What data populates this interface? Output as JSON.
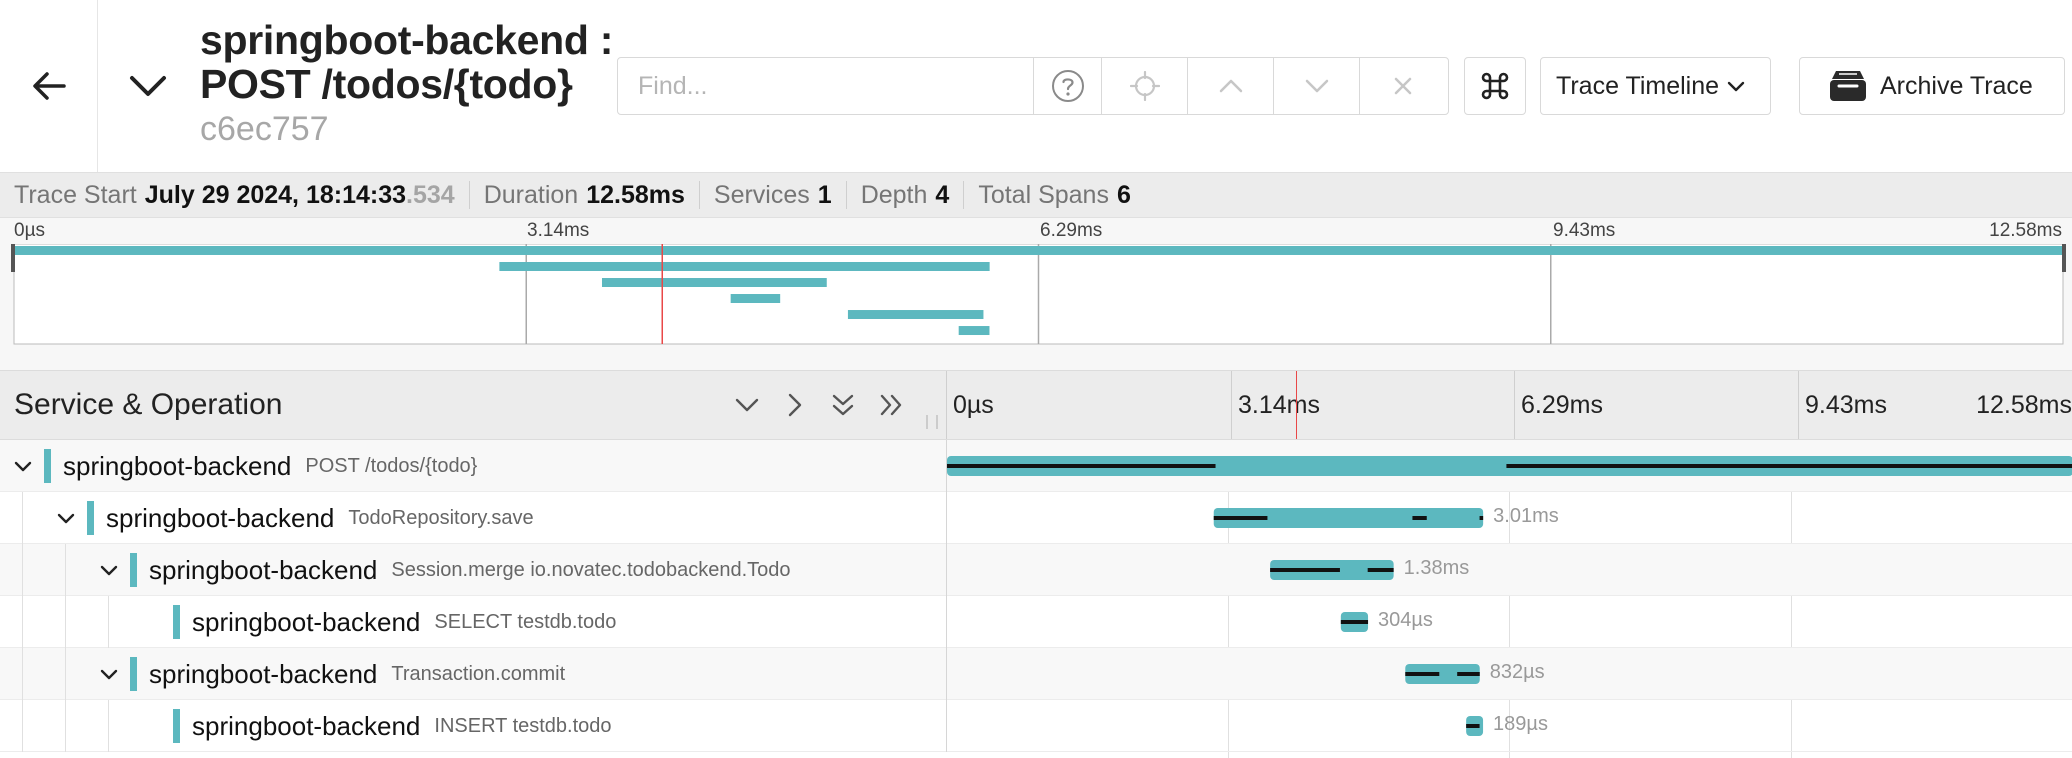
{
  "header": {
    "title_line1": "springboot-backend :",
    "title_line2": "POST /todos/{todo}",
    "trace_id": "c6ec757",
    "find_placeholder": "Find...",
    "view_dropdown": "Trace Timeline",
    "archive_label": "Archive Trace"
  },
  "icons": {
    "back": "arrow-left-icon",
    "collapse": "chevron-down-icon",
    "help": "question-circle-icon",
    "locate": "crosshair-icon",
    "prev": "chevron-up-icon",
    "next": "chevron-down-icon",
    "clear": "close-icon",
    "shortcuts": "command-key-icon",
    "archive": "archive-box-icon"
  },
  "summary": {
    "trace_start_label": "Trace Start",
    "trace_start_value": "July 29 2024, 18:14:33",
    "trace_start_ms": ".534",
    "duration_label": "Duration",
    "duration_value": "12.58ms",
    "services_label": "Services",
    "services_value": "1",
    "depth_label": "Depth",
    "depth_value": "4",
    "total_spans_label": "Total Spans",
    "total_spans_value": "6"
  },
  "timeline": {
    "ticks": [
      "0µs",
      "3.14ms",
      "6.29ms",
      "9.43ms",
      "12.58ms"
    ],
    "total_ms": 12.58,
    "cursor_ms": 3.98
  },
  "table": {
    "left_header": "Service & Operation"
  },
  "colors": {
    "span_bar": "#5cb8bf",
    "cursor": "#e94848"
  },
  "spans": [
    {
      "service": "springboot-backend",
      "operation": "POST /todos/{todo}",
      "depth": 0,
      "has_children": true,
      "start_ms": 0.0,
      "duration_ms": 12.58,
      "duration_label": "",
      "self": [
        [
          0.0,
          3.0
        ],
        [
          6.25,
          12.58
        ]
      ]
    },
    {
      "service": "springboot-backend",
      "operation": "TodoRepository.save",
      "depth": 1,
      "has_children": true,
      "start_ms": 2.98,
      "duration_ms": 3.01,
      "duration_label": "3.01ms",
      "self": [
        [
          2.98,
          3.58
        ],
        [
          5.2,
          5.36
        ],
        [
          5.95,
          5.99
        ]
      ]
    },
    {
      "service": "springboot-backend",
      "operation": "Session.merge io.novatec.todobackend.Todo",
      "depth": 2,
      "has_children": true,
      "start_ms": 3.61,
      "duration_ms": 1.38,
      "duration_label": "1.38ms",
      "self": [
        [
          3.61,
          4.39
        ],
        [
          4.7,
          4.99
        ]
      ]
    },
    {
      "service": "springboot-backend",
      "operation": "SELECT testdb.todo",
      "depth": 3,
      "has_children": false,
      "start_ms": 4.4,
      "duration_ms": 0.304,
      "duration_label": "304µs",
      "self": [
        [
          4.4,
          4.704
        ]
      ]
    },
    {
      "service": "springboot-backend",
      "operation": "Transaction.commit",
      "depth": 2,
      "has_children": true,
      "start_ms": 5.12,
      "duration_ms": 0.832,
      "duration_label": "832µs",
      "self": [
        [
          5.12,
          5.5
        ],
        [
          5.7,
          5.952
        ]
      ]
    },
    {
      "service": "springboot-backend",
      "operation": "INSERT testdb.todo",
      "depth": 3,
      "has_children": false,
      "start_ms": 5.8,
      "duration_ms": 0.189,
      "duration_label": "189µs",
      "self": [
        [
          5.8,
          5.95
        ]
      ]
    }
  ]
}
